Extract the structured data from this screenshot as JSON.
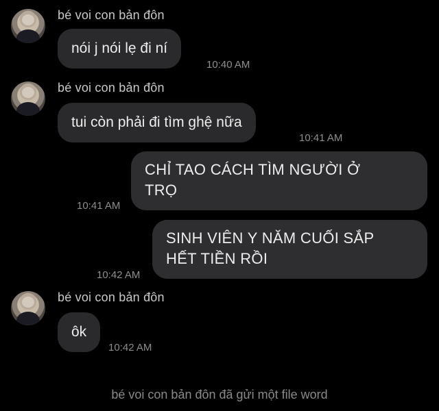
{
  "contact": {
    "name": "bé voi con bản đôn"
  },
  "messages": [
    {
      "direction": "in",
      "sender": "bé voi con bản đôn",
      "text": "nói j nói lẹ đi ní",
      "time": "10:40 AM"
    },
    {
      "direction": "in",
      "sender": "bé voi con bản đôn",
      "text": "tui còn phải đi tìm ghệ nữa",
      "time": "10:41 AM"
    },
    {
      "direction": "out",
      "text_line1": "CHỈ TAO CÁCH TÌM NGƯỜI Ở",
      "text_line2": "TRỌ",
      "time": "10:41 AM"
    },
    {
      "direction": "out",
      "text_line1": "SINH VIÊN Y NĂM CUỐI SẮP",
      "text_line2": "HẾT TIỀN RỒI",
      "time": "10:42 AM"
    },
    {
      "direction": "in",
      "sender": "bé voi con bản đôn",
      "text": "ôk",
      "time": "10:42 AM"
    }
  ],
  "notice": "bé voi con bản đôn đã gửi một file word"
}
